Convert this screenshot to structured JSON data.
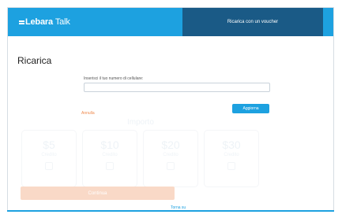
{
  "header": {
    "logo_text": "Lebara",
    "logo_suffix": "Talk",
    "voucher_link": "Ricarica con un voucher"
  },
  "main": {
    "title": "Ricarica",
    "phone_label": "Inserisci il tuo numero di cellulare:",
    "phone_value": "",
    "cancel_label": "Annulla",
    "update_label": "Aggiorna",
    "amount_title": "Importo",
    "amounts": [
      {
        "value": "$5",
        "label": "Credito"
      },
      {
        "value": "$10",
        "label": "Credito"
      },
      {
        "value": "$20",
        "label": "Credito"
      },
      {
        "value": "$30",
        "label": "Credito"
      }
    ],
    "recharge_label": "Continua",
    "scroll_top_label": "Torna su"
  },
  "colors": {
    "brand_blue": "#1da1e0",
    "dark_blue": "#1a5a86",
    "accent_orange": "#ef8a4d",
    "disabled_button": "#f9d9c7"
  }
}
